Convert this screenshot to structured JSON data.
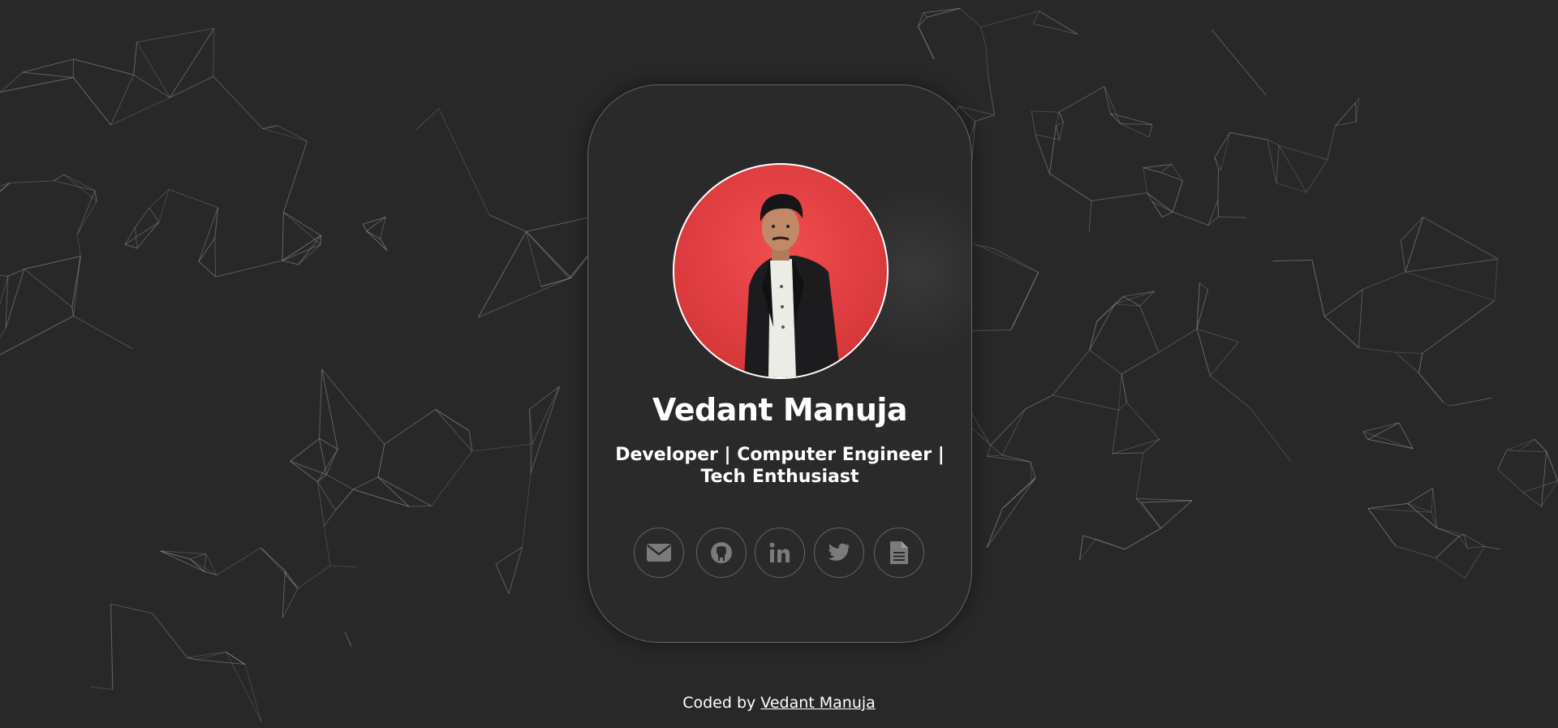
{
  "profile": {
    "name": "Vedant Manuja",
    "tagline_line1": "Developer | Computer Engineer |",
    "tagline_line2": "Tech Enthusiast"
  },
  "socials": [
    {
      "icon": "envelope-icon"
    },
    {
      "icon": "github-icon"
    },
    {
      "icon": "linkedin-icon"
    },
    {
      "icon": "twitter-icon"
    },
    {
      "icon": "document-icon"
    }
  ],
  "footer": {
    "prefix": "Coded by ",
    "link_text": "Vedant Manuja"
  },
  "colors": {
    "background": "#282828",
    "card": "#2a2a2a",
    "avatar_bg": "#e03f41",
    "icon": "#7b7b7b",
    "network_lines": "#9a9a9a"
  }
}
